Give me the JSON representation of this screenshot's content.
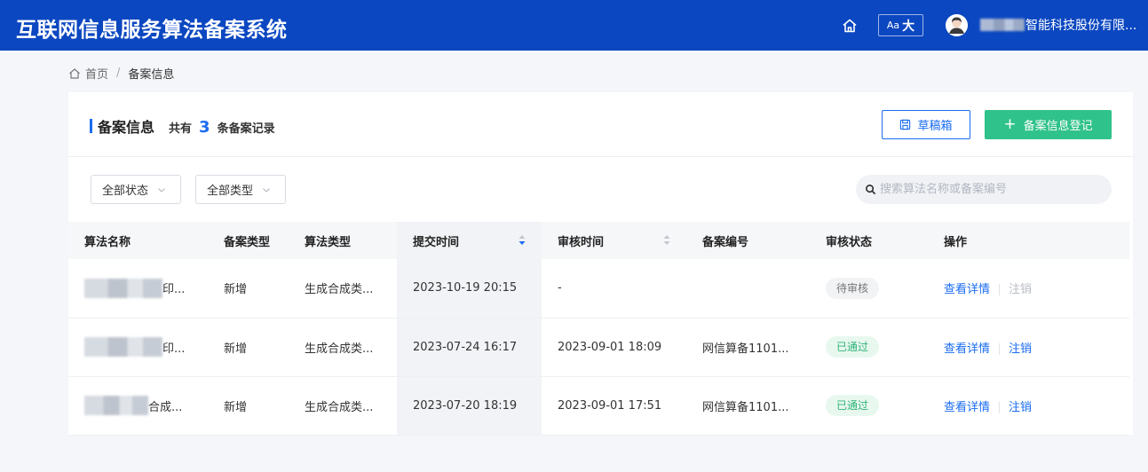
{
  "app": {
    "title": "互联网信息服务算法备案系统",
    "font_size_label_small": "Aa",
    "font_size_label_big": "大",
    "org_name_suffix": "智能科技股份有限..."
  },
  "breadcrumb": {
    "home": "首页",
    "separator": "/",
    "current": "备案信息"
  },
  "card": {
    "title": "备案信息",
    "count_prefix": "共有",
    "count": "3",
    "count_suffix": "条备案记录",
    "draft_button": "草稿箱",
    "register_button": "备案信息登记"
  },
  "filters": {
    "status": "全部状态",
    "type": "全部类型"
  },
  "search": {
    "placeholder": "搜索算法名称或备案编号"
  },
  "table": {
    "headers": [
      "算法名称",
      "备案类型",
      "算法类型",
      "提交时间",
      "审核时间",
      "备案编号",
      "审核状态",
      "操作"
    ],
    "rows": [
      {
        "name_suffix": "印...",
        "filing_type": "新增",
        "algo_type": "生成合成类...",
        "submit_time": "2023-10-19 20:15",
        "review_time": "-",
        "filing_no": "",
        "status": "待审核",
        "view": "查看详情",
        "cancel": "注销"
      },
      {
        "name_suffix": "印...",
        "filing_type": "新增",
        "algo_type": "生成合成类...",
        "submit_time": "2023-07-24 16:17",
        "review_time": "2023-09-01 18:09",
        "filing_no": "网信算备1101...",
        "status": "已通过",
        "view": "查看详情",
        "cancel": "注销"
      },
      {
        "name_suffix": "合成...",
        "filing_type": "新增",
        "algo_type": "生成合成类...",
        "submit_time": "2023-07-20 18:19",
        "review_time": "2023-09-01 17:51",
        "filing_no": "网信算备1101...",
        "status": "已通过",
        "view": "查看详情",
        "cancel": "注销"
      }
    ]
  },
  "colors": {
    "header_bg": "#0b47c1",
    "accent": "#1a6cf0",
    "success": "#2fc28a"
  },
  "icons": [
    "home-icon",
    "font-size-icon",
    "avatar",
    "save-icon",
    "plus-icon",
    "chevron-down-icon",
    "search-icon",
    "sort-icon"
  ]
}
